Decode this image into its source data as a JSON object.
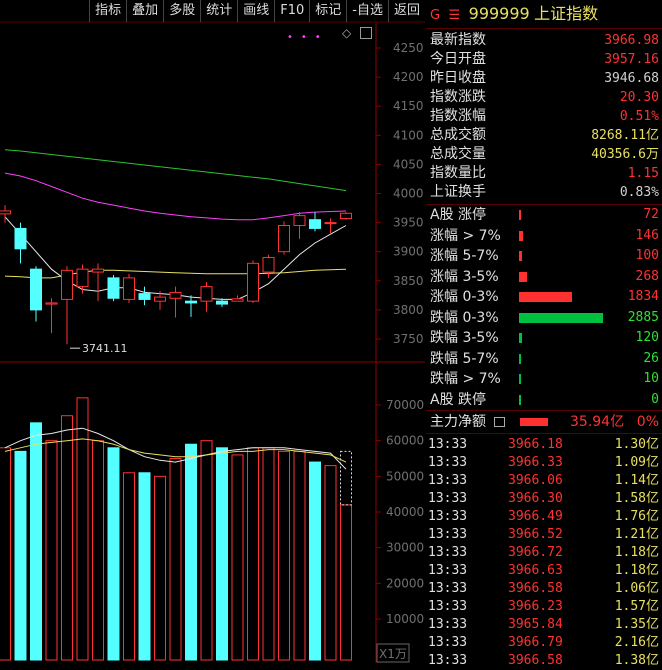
{
  "toolbar": {
    "buttons": [
      "指标",
      "叠加",
      "多股",
      "统计",
      "画线",
      "F10",
      "标记",
      "-自选",
      "返回"
    ]
  },
  "chart": {
    "price_axis": [
      "4250",
      "4200",
      "4150",
      "4100",
      "4050",
      "4000",
      "3950",
      "3900",
      "3850",
      "3800",
      "3750"
    ],
    "volume_axis": [
      "70000",
      "60000",
      "50000",
      "40000",
      "30000",
      "20000",
      "10000"
    ],
    "volume_unit": "X1万",
    "low_marker": "3741.11"
  },
  "colors": {
    "up": "#ff3232",
    "down": "#54ffff",
    "ma_white": "#e8e8e8",
    "ma_yellow": "#e8e060",
    "ma_magenta": "#ff40ff",
    "ma_green": "#30c030",
    "panel_up_bar": "#ff3030",
    "panel_down_bar": "#00c040"
  },
  "header": {
    "g_mark": "G",
    "menu_icon": "menu-icon",
    "code": "999999",
    "name": "上证指数"
  },
  "quote": [
    {
      "label": "最新指数",
      "value": "3966.98",
      "color": "#ff3232"
    },
    {
      "label": "今日开盘",
      "value": "3957.16",
      "color": "#ff3232"
    },
    {
      "label": "昨日收盘",
      "value": "3946.68",
      "color": "#d0d0d0"
    },
    {
      "label": "指数涨跌",
      "value": "20.30",
      "color": "#ff3232"
    },
    {
      "label": "指数涨幅",
      "value": "0.51%",
      "color": "#ff3232"
    },
    {
      "label": "总成交额",
      "value": "8268.11亿",
      "color": "#e8e060"
    },
    {
      "label": "总成交量",
      "value": "40356.6万",
      "color": "#e8e060"
    },
    {
      "label": "指数量比",
      "value": "1.15",
      "color": "#ff3232"
    },
    {
      "label": "上证换手",
      "value": "0.83%",
      "color": "#d0d0d0"
    }
  ],
  "distribution": [
    {
      "label": "A股 涨停",
      "value": "72",
      "count": 72,
      "type": "up"
    },
    {
      "label": "涨幅 > 7%",
      "value": "146",
      "count": 146,
      "type": "up"
    },
    {
      "label": "涨幅 5-7%",
      "value": "100",
      "count": 100,
      "type": "up"
    },
    {
      "label": "涨幅 3-5%",
      "value": "268",
      "count": 268,
      "type": "up"
    },
    {
      "label": "涨幅 0-3%",
      "value": "1834",
      "count": 1834,
      "type": "up"
    },
    {
      "label": "跌幅 0-3%",
      "value": "2885",
      "count": 2885,
      "type": "down"
    },
    {
      "label": "跌幅 3-5%",
      "value": "120",
      "count": 120,
      "type": "down"
    },
    {
      "label": "跌幅 5-7%",
      "value": "26",
      "count": 26,
      "type": "down"
    },
    {
      "label": "跌幅 > 7%",
      "value": "10",
      "count": 10,
      "type": "down"
    },
    {
      "label": "A股 跌停",
      "value": "0",
      "count": 0,
      "type": "down"
    }
  ],
  "main_force": {
    "label": "主力净额",
    "value": "35.94亿",
    "pct": "0%"
  },
  "ticks": [
    {
      "time": "13:33",
      "price": "3966.18",
      "vol": "1.30亿"
    },
    {
      "time": "13:33",
      "price": "3966.33",
      "vol": "1.09亿"
    },
    {
      "time": "13:33",
      "price": "3966.06",
      "vol": "1.14亿"
    },
    {
      "time": "13:33",
      "price": "3966.30",
      "vol": "1.58亿"
    },
    {
      "time": "13:33",
      "price": "3966.49",
      "vol": "1.76亿"
    },
    {
      "time": "13:33",
      "price": "3966.52",
      "vol": "1.21亿"
    },
    {
      "time": "13:33",
      "price": "3966.72",
      "vol": "1.18亿"
    },
    {
      "time": "13:33",
      "price": "3966.63",
      "vol": "1.18亿"
    },
    {
      "time": "13:33",
      "price": "3966.58",
      "vol": "1.06亿"
    },
    {
      "time": "13:33",
      "price": "3966.23",
      "vol": "1.57亿"
    },
    {
      "time": "13:33",
      "price": "3965.84",
      "vol": "1.35亿"
    },
    {
      "time": "13:33",
      "price": "3966.79",
      "vol": "2.16亿"
    },
    {
      "time": "13:33",
      "price": "3966.58",
      "vol": "1.38亿"
    }
  ],
  "candles": [
    {
      "o": 3965,
      "c": 3970,
      "h": 3980,
      "l": 3950
    },
    {
      "o": 3940,
      "c": 3905,
      "h": 3950,
      "l": 3880
    },
    {
      "o": 3870,
      "c": 3800,
      "h": 3875,
      "l": 3780
    },
    {
      "o": 3810,
      "c": 3812,
      "h": 3820,
      "l": 3760
    },
    {
      "o": 3818,
      "c": 3868,
      "h": 3875,
      "l": 3741
    },
    {
      "o": 3840,
      "c": 3870,
      "h": 3878,
      "l": 3828
    },
    {
      "o": 3865,
      "c": 3870,
      "h": 3880,
      "l": 3815
    },
    {
      "o": 3855,
      "c": 3820,
      "h": 3860,
      "l": 3815
    },
    {
      "o": 3818,
      "c": 3855,
      "h": 3862,
      "l": 3812
    },
    {
      "o": 3828,
      "c": 3818,
      "h": 3840,
      "l": 3808
    },
    {
      "o": 3815,
      "c": 3822,
      "h": 3833,
      "l": 3800
    },
    {
      "o": 3820,
      "c": 3830,
      "h": 3840,
      "l": 3787
    },
    {
      "o": 3815,
      "c": 3812,
      "h": 3825,
      "l": 3788
    },
    {
      "o": 3815,
      "c": 3840,
      "h": 3848,
      "l": 3797
    },
    {
      "o": 3815,
      "c": 3810,
      "h": 3820,
      "l": 3805
    },
    {
      "o": 3815,
      "c": 3819,
      "h": 3825,
      "l": 3815
    },
    {
      "o": 3815,
      "c": 3880,
      "h": 3885,
      "l": 3812
    },
    {
      "o": 3865,
      "c": 3890,
      "h": 3895,
      "l": 3855
    },
    {
      "o": 3900,
      "c": 3945,
      "h": 3952,
      "l": 3895
    },
    {
      "o": 3945,
      "c": 3962,
      "h": 3968,
      "l": 3922
    },
    {
      "o": 3955,
      "c": 3940,
      "h": 3968,
      "l": 3935
    },
    {
      "o": 3950,
      "c": 3950,
      "h": 3957,
      "l": 3932
    },
    {
      "o": 3957,
      "c": 3966,
      "h": 3968,
      "l": 3955
    }
  ],
  "volumes": [
    58000,
    57000,
    65000,
    60000,
    67000,
    72000,
    60000,
    58000,
    51000,
    51000,
    50000,
    55000,
    59000,
    60000,
    58000,
    56000,
    58000,
    58000,
    57000,
    57000,
    54000,
    53000,
    42000
  ],
  "ma": {
    "white": [
      3960,
      3930,
      3900,
      3870,
      3850,
      3835,
      3832,
      3838,
      3838,
      3830,
      3828,
      3826,
      3822,
      3820,
      3818,
      3818,
      3830,
      3845,
      3870,
      3895,
      3915,
      3930,
      3945
    ],
    "yellow": [
      3858,
      3857,
      3855,
      3855,
      3860,
      3865,
      3868,
      3868,
      3867,
      3866,
      3865,
      3864,
      3863,
      3862,
      3862,
      3862,
      3862,
      3863,
      3864,
      3866,
      3868,
      3869,
      3870
    ],
    "magenta": [
      4035,
      4030,
      4022,
      4012,
      4002,
      3992,
      3985,
      3980,
      3975,
      3970,
      3966,
      3963,
      3960,
      3958,
      3956,
      3955,
      3955,
      3958,
      3962,
      3966,
      3968,
      3969,
      3970
    ],
    "green": [
      4075,
      4073,
      4070,
      4067,
      4064,
      4061,
      4058,
      4055,
      4052,
      4049,
      4046,
      4043,
      4040,
      4037,
      4034,
      4031,
      4028,
      4025,
      4021,
      4017,
      4013,
      4009,
      4005
    ],
    "vol_white": [
      58000,
      60000,
      61500,
      62000,
      63000,
      63500,
      62000,
      60000,
      57500,
      55500,
      54500,
      54000,
      55000,
      56000,
      57000,
      57500,
      58000,
      58000,
      58000,
      57500,
      57000,
      56500,
      52000
    ],
    "vol_yellow": [
      57000,
      58000,
      59000,
      59500,
      60000,
      60500,
      60000,
      59000,
      57500,
      56500,
      56000,
      55500,
      55500,
      56000,
      56500,
      57000,
      57000,
      57500,
      57500,
      57000,
      56500,
      56000,
      54000
    ]
  }
}
